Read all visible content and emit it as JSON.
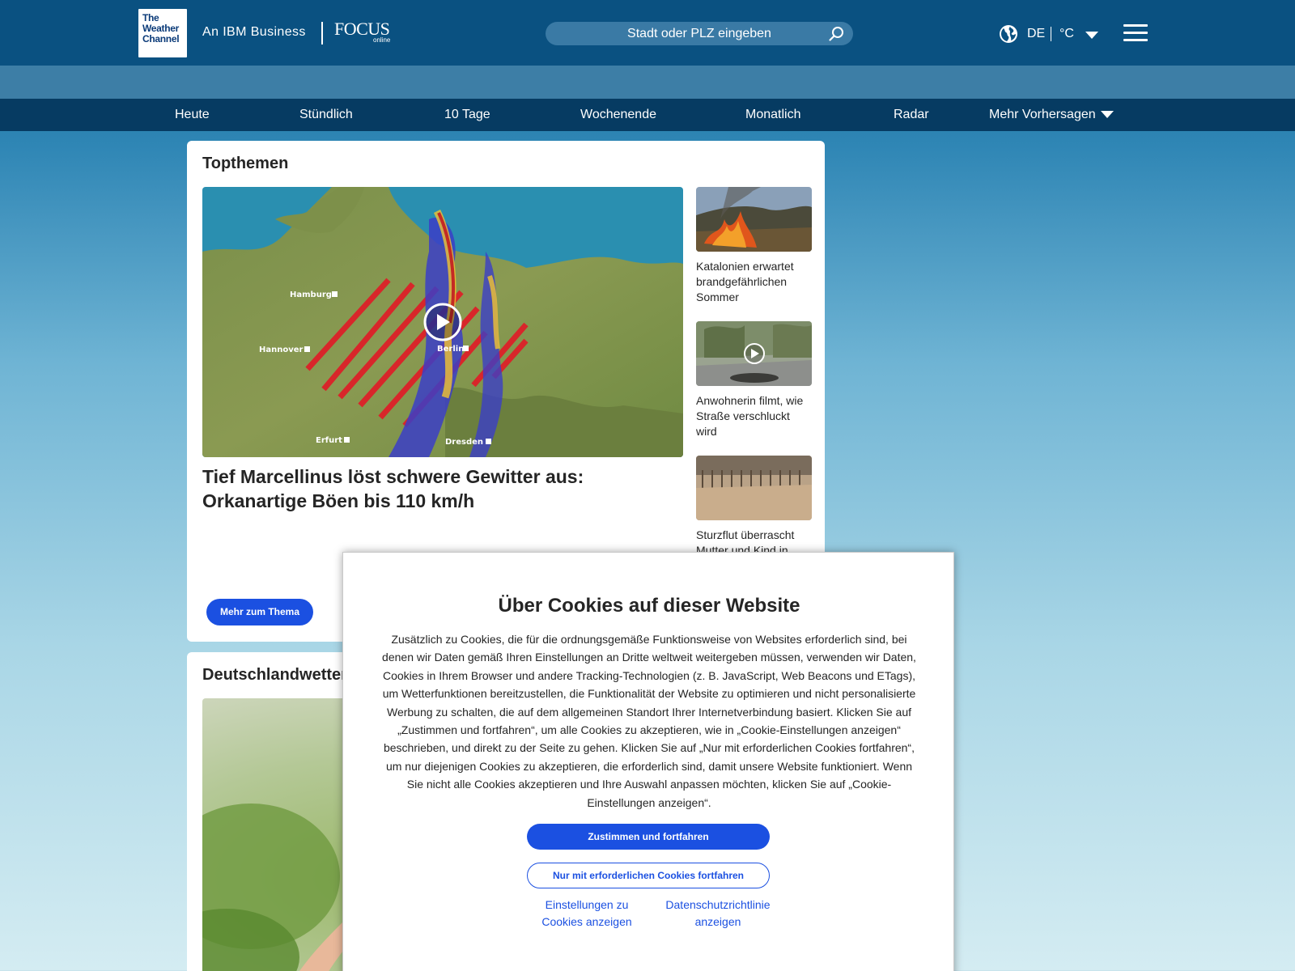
{
  "header": {
    "logo_lines": [
      "The",
      "Weather",
      "Channel"
    ],
    "ibm_text": "An IBM Business",
    "focus_logo": "FOCUS",
    "focus_sub": "online",
    "search_placeholder": "Stadt oder PLZ eingeben",
    "language": "DE",
    "unit": "°C"
  },
  "nav": {
    "items": [
      "Heute",
      "Stündlich",
      "10 Tage",
      "Wochenende",
      "Monatlich",
      "Radar",
      "Mehr Vorhersagen"
    ]
  },
  "topthemen": {
    "title": "Topthemen",
    "hero_title": "Tief Marcellinus löst schwere Gewitter aus: Orkanartige Böen bis 110 km/h",
    "more_button": "Mehr zum Thema",
    "map_cities": [
      "Hamburg",
      "Hannover",
      "Berlin",
      "Erfurt",
      "Dresden"
    ],
    "side_stories": [
      {
        "caption": "Katalonien erwartet brandgefährlichen Sommer"
      },
      {
        "caption": "Anwohnerin filmt, wie Straße verschluckt wird"
      },
      {
        "caption": "Sturzflut überrascht Mutter und Kind in"
      }
    ]
  },
  "deutschlandwetter": {
    "title": "Deutschlandwetter"
  },
  "cookie_modal": {
    "title": "Über Cookies auf dieser Website",
    "body": "Zusätzlich zu Cookies, die für die ordnungsgemäße Funktionsweise von Websites erforderlich sind, bei denen wir Daten gemäß Ihren Einstellungen an Dritte weltweit weitergeben müssen, verwenden wir Daten, Cookies in Ihrem Browser und andere Tracking-Technologien (z. B. JavaScript, Web Beacons und ETags), um Wetterfunktionen bereitzustellen, die Funktionalität der Website zu optimieren und nicht personalisierte Werbung zu schalten, die auf dem allgemeinen Standort Ihrer Internetverbindung basiert. Klicken Sie auf „Zustimmen und fortfahren“, um alle Cookies zu akzeptieren, wie in „Cookie-Einstellungen anzeigen“ beschrieben, und direkt zu der Seite zu gehen. Klicken Sie auf „Nur mit erforderlichen Cookies fortfahren“, um nur diejenigen Cookies zu akzeptieren, die erforderlich sind, damit unsere Website funktioniert. Wenn Sie nicht alle Cookies akzeptieren und Ihre Auswahl anpassen möchten, klicken Sie auf „Cookie-Einstellungen anzeigen“.",
    "accept_button": "Zustimmen und fortfahren",
    "essential_button": "Nur mit erforderlichen Cookies fortfahren",
    "settings_link": "Einstellungen zu Cookies anzeigen",
    "privacy_link": "Datenschutzrichtlinie anzeigen"
  },
  "colors": {
    "header_bg": "#0a5181",
    "nav_bg": "#063b62",
    "accent_blue": "#1b50e1"
  }
}
